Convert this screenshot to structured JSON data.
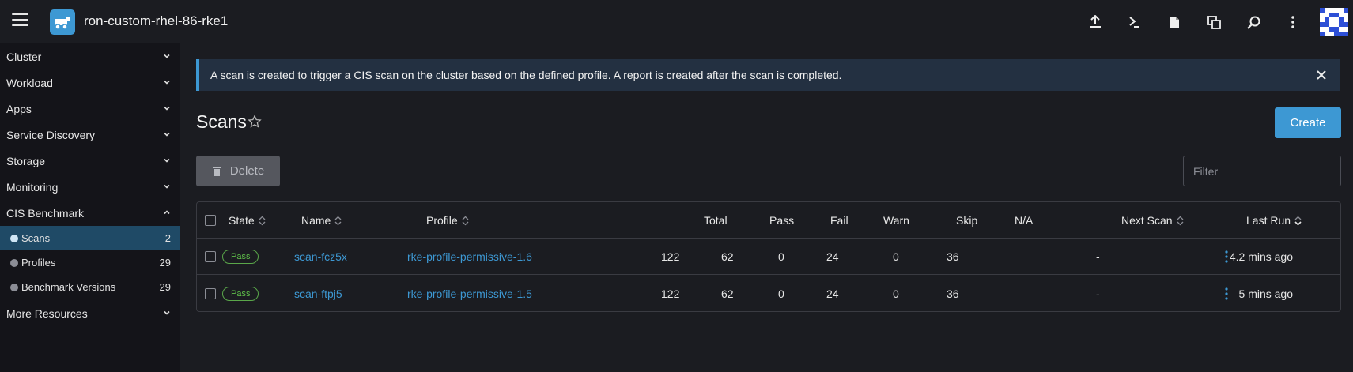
{
  "header": {
    "cluster_name": "ron-custom-rhel-86-rke1",
    "icons": [
      "upload-icon",
      "terminal-icon",
      "file-icon",
      "copy-icon",
      "search-icon",
      "more-vertical-icon"
    ]
  },
  "sidebar": {
    "groups": [
      {
        "label": "Cluster"
      },
      {
        "label": "Workload"
      },
      {
        "label": "Apps"
      },
      {
        "label": "Service Discovery"
      },
      {
        "label": "Storage"
      },
      {
        "label": "Monitoring"
      },
      {
        "label": "CIS Benchmark"
      }
    ],
    "items": [
      {
        "label": "Scans",
        "count": "2"
      },
      {
        "label": "Profiles",
        "count": "29"
      },
      {
        "label": "Benchmark Versions",
        "count": "29"
      }
    ],
    "more": "More Resources"
  },
  "banner": {
    "text": "A scan is created to trigger a CIS scan on the cluster based on the defined profile. A report is created after the scan is completed."
  },
  "page": {
    "title": "Scans",
    "create_label": "Create",
    "delete_label": "Delete",
    "filter_placeholder": "Filter"
  },
  "table": {
    "columns": [
      "State",
      "Name",
      "Profile",
      "Total",
      "Pass",
      "Fail",
      "Warn",
      "Skip",
      "N/A",
      "Next Scan",
      "Last Run"
    ],
    "rows": [
      {
        "state": "Pass",
        "name": "scan-fcz5x",
        "profile": "rke-profile-permissive-1.6",
        "total": "122",
        "pass": "62",
        "fail": "0",
        "warn": "24",
        "skip": "0",
        "na": "36",
        "next_scan": "-",
        "last_run": "4.2 mins ago"
      },
      {
        "state": "Pass",
        "name": "scan-ftpj5",
        "profile": "rke-profile-permissive-1.5",
        "total": "122",
        "pass": "62",
        "fail": "0",
        "warn": "24",
        "skip": "0",
        "na": "36",
        "next_scan": "-",
        "last_run": "5 mins ago"
      }
    ]
  },
  "colors": {
    "accent": "#3d98d3",
    "pass_badge": "#5fbf4a",
    "active_nav": "#1f4a66",
    "banner_bg": "#233041"
  }
}
